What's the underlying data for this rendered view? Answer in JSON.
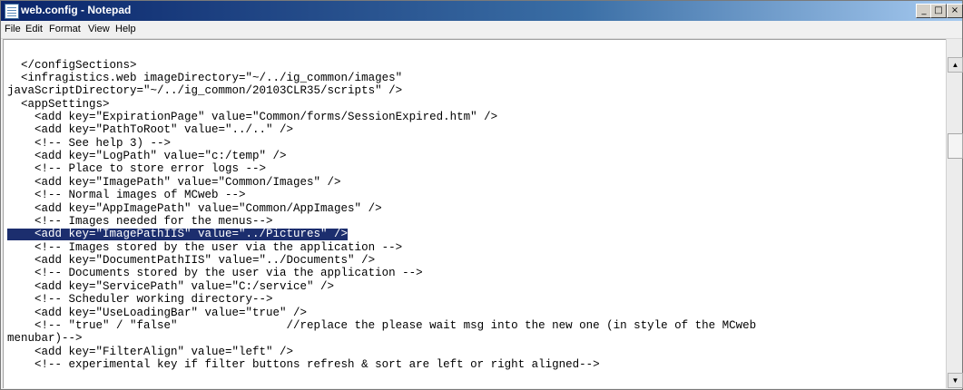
{
  "window": {
    "title": "web.config - Notepad",
    "icon": "notepad-icon",
    "controls": {
      "minimize": "_",
      "maximize": "□",
      "close": "×"
    }
  },
  "menu": [
    "File",
    "Edit",
    "Format",
    "View",
    "Help"
  ],
  "editor": {
    "selected_line_index": 14,
    "lines": [
      "  </configSections>",
      "  <infragistics.web imageDirectory=\"~/../ig_common/images\"",
      "javaScriptDirectory=\"~/../ig_common/20103CLR35/scripts\" />",
      "  <appSettings>",
      "    <add key=\"ExpirationPage\" value=\"Common/forms/SessionExpired.htm\" />",
      "    <add key=\"PathToRoot\" value=\"../..\" />",
      "    <!-- See help 3) -->",
      "    <add key=\"LogPath\" value=\"c:/temp\" />",
      "    <!-- Place to store error logs -->",
      "    <add key=\"ImagePath\" value=\"Common/Images\" />",
      "    <!-- Normal images of MCweb -->",
      "    <add key=\"AppImagePath\" value=\"Common/AppImages\" />",
      "    <!-- Images needed for the menus-->",
      "    <add key=\"ImagePathIIS\" value=\"../Pictures\" />",
      "    <!-- Images stored by the user via the application -->",
      "    <add key=\"DocumentPathIIS\" value=\"../Documents\" />",
      "    <!-- Documents stored by the user via the application -->",
      "    <add key=\"ServicePath\" value=\"C:/service\" />",
      "    <!-- Scheduler working directory-->",
      "    <add key=\"UseLoadingBar\" value=\"true\" />",
      "    <!-- \"true\" / \"false\"                //replace the please wait msg into the new one (in style of the MCweb",
      "menubar)-->",
      "    <add key=\"FilterAlign\" value=\"left\" />",
      "    <!-- experimental key if filter buttons refresh & sort are left or right aligned-->"
    ]
  },
  "scrollbar": {
    "up_arrow": "▲",
    "down_arrow": "▼"
  }
}
